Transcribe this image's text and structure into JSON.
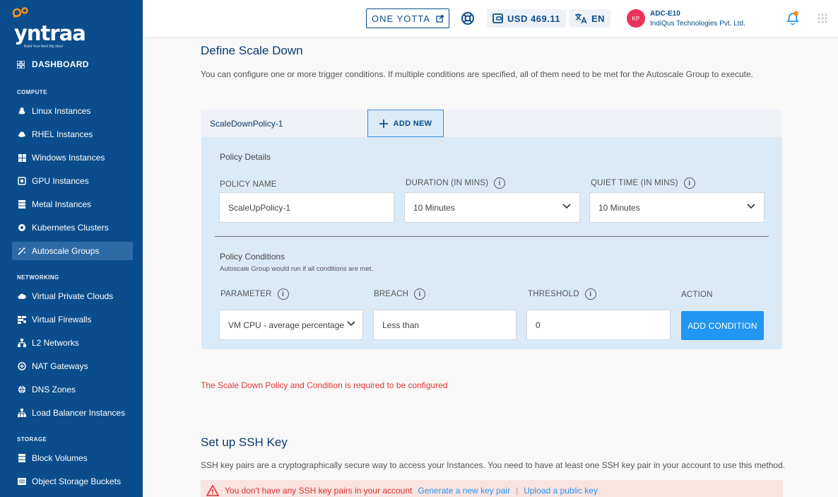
{
  "brand": {
    "name": "yntraa",
    "tagline": "Build Your Next Big Idea!"
  },
  "sidebar": {
    "dashboard": "DASHBOARD",
    "sections": {
      "compute": "COMPUTE",
      "networking": "NETWORKING",
      "storage": "STORAGE"
    },
    "compute": [
      "Linux Instances",
      "RHEL Instances",
      "Windows Instances",
      "GPU Instances",
      "Metal Instances",
      "Kubernetes Clusters",
      "Autoscale Groups"
    ],
    "networking": [
      "Virtual Private Clouds",
      "Virtual Firewalls",
      "L2 Networks",
      "NAT Gateways",
      "DNS Zones",
      "Load Balancer Instances"
    ],
    "storage": [
      "Block Volumes",
      "Object Storage Buckets"
    ],
    "active": "Autoscale Groups"
  },
  "topbar": {
    "one_yotta": "ONE YOTTA",
    "balance": "USD 469.11",
    "language": "EN",
    "avatar_initials": "KP",
    "account_id": "ADC-E10",
    "company": "IndiQus Technologies Pvt. Ltd."
  },
  "scale_down": {
    "title": "Define Scale Down",
    "description": "You can configure one or more trigger conditions. If multiple conditions are specified, all of them need to be met for the Autoscale Group to execute.",
    "tab": "ScaleDownPolicy-1",
    "add_new": "ADD NEW",
    "policy_details": "Policy Details",
    "policy_name_label": "POLICY NAME",
    "policy_name_value": "ScaleUpPolicy-1",
    "duration_label": "DURATION (IN MINS)",
    "duration_value": "10 Minutes",
    "quiet_label": "QUIET TIME (IN MINS)",
    "quiet_value": "10 Minutes",
    "conditions_title": "Policy Conditions",
    "conditions_sub": "Autoscale Group would run if all conditions are met.",
    "parameter_label": "PARAMETER",
    "parameter_value": "VM CPU - average percentage",
    "breach_label": "BREACH",
    "breach_value": "Less than",
    "threshold_label": "THRESHOLD",
    "threshold_value": "0",
    "action_label": "ACTION",
    "add_condition": "ADD CONDITION",
    "error": "The Scale Down Policy and Condition is required to be configured"
  },
  "ssh": {
    "title": "Set up SSH Key",
    "description": "SSH key pairs are a cryptographically secure way to access your Instances. You need to have at least one SSH key pair in your account to use this method.",
    "alert": "You don't have any SSH key pairs in your account",
    "generate": "Generate a new key pair",
    "separator": "|",
    "upload": "Upload a public key"
  },
  "colors": {
    "sidebar": "#0b4d8c",
    "accent": "#2196f3",
    "error": "#e53935",
    "panel": "#dbeaf7"
  }
}
